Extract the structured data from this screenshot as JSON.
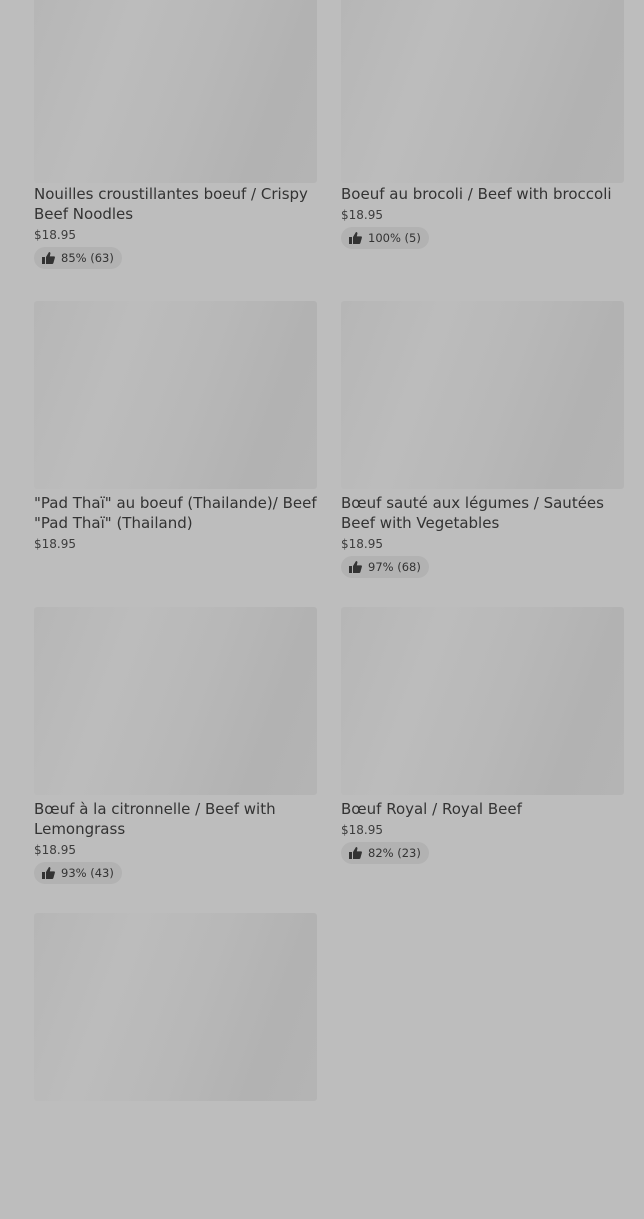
{
  "items": [
    {
      "title": "",
      "price": "",
      "rating": ""
    },
    {
      "title": "",
      "price": "",
      "rating": ""
    },
    {
      "title": "Nouilles croustillantes boeuf / Crispy Beef Noodles",
      "price": "$18.95",
      "rating": "85% (63)"
    },
    {
      "title": "Boeuf au brocoli / Beef with broccoli",
      "price": "$18.95",
      "rating": "100% (5)"
    },
    {
      "title": "\"Pad Thaï\" au boeuf (Thailande)/ Beef \"Pad Thaï\" (Thailand)",
      "price": "$18.95",
      "rating": ""
    },
    {
      "title": "Bœuf sauté aux légumes / Sautées Beef with Vegetables",
      "price": "$18.95",
      "rating": "97% (68)"
    },
    {
      "title": "Bœuf à la citronnelle / Beef with Lemongrass",
      "price": "$18.95",
      "rating": "93% (43)"
    },
    {
      "title": "Bœuf Royal / Royal Beef",
      "price": "$18.95",
      "rating": "82% (23)"
    },
    {
      "title": "",
      "price": "",
      "rating": ""
    }
  ],
  "icons": {
    "rating": "thumbs-up-icon"
  }
}
